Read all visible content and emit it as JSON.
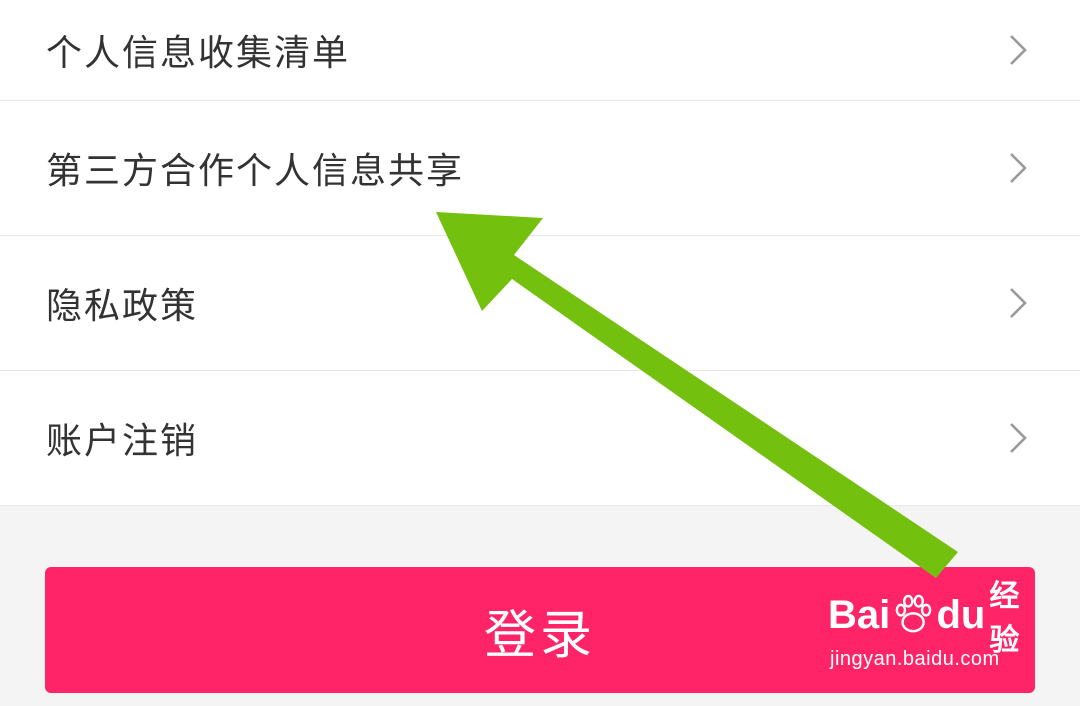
{
  "menu": {
    "items": [
      {
        "label": "个人信息收集清单"
      },
      {
        "label": "第三方合作个人信息共享"
      },
      {
        "label": "隐私政策"
      },
      {
        "label": "账户注销"
      }
    ]
  },
  "login": {
    "label": "登录"
  },
  "annotation": {
    "arrow_color": "#73c00f",
    "arrow_icon": "arrow-pointer-icon"
  },
  "watermark": {
    "logo_bai": "Bai",
    "logo_du": "du",
    "logo_jingyan": "经验",
    "url": "jingyan.baidu.com"
  },
  "colors": {
    "accent": "#ff2468",
    "background": "#f4f4f4",
    "row_text": "#333333",
    "chevron": "#9a9a9a"
  }
}
